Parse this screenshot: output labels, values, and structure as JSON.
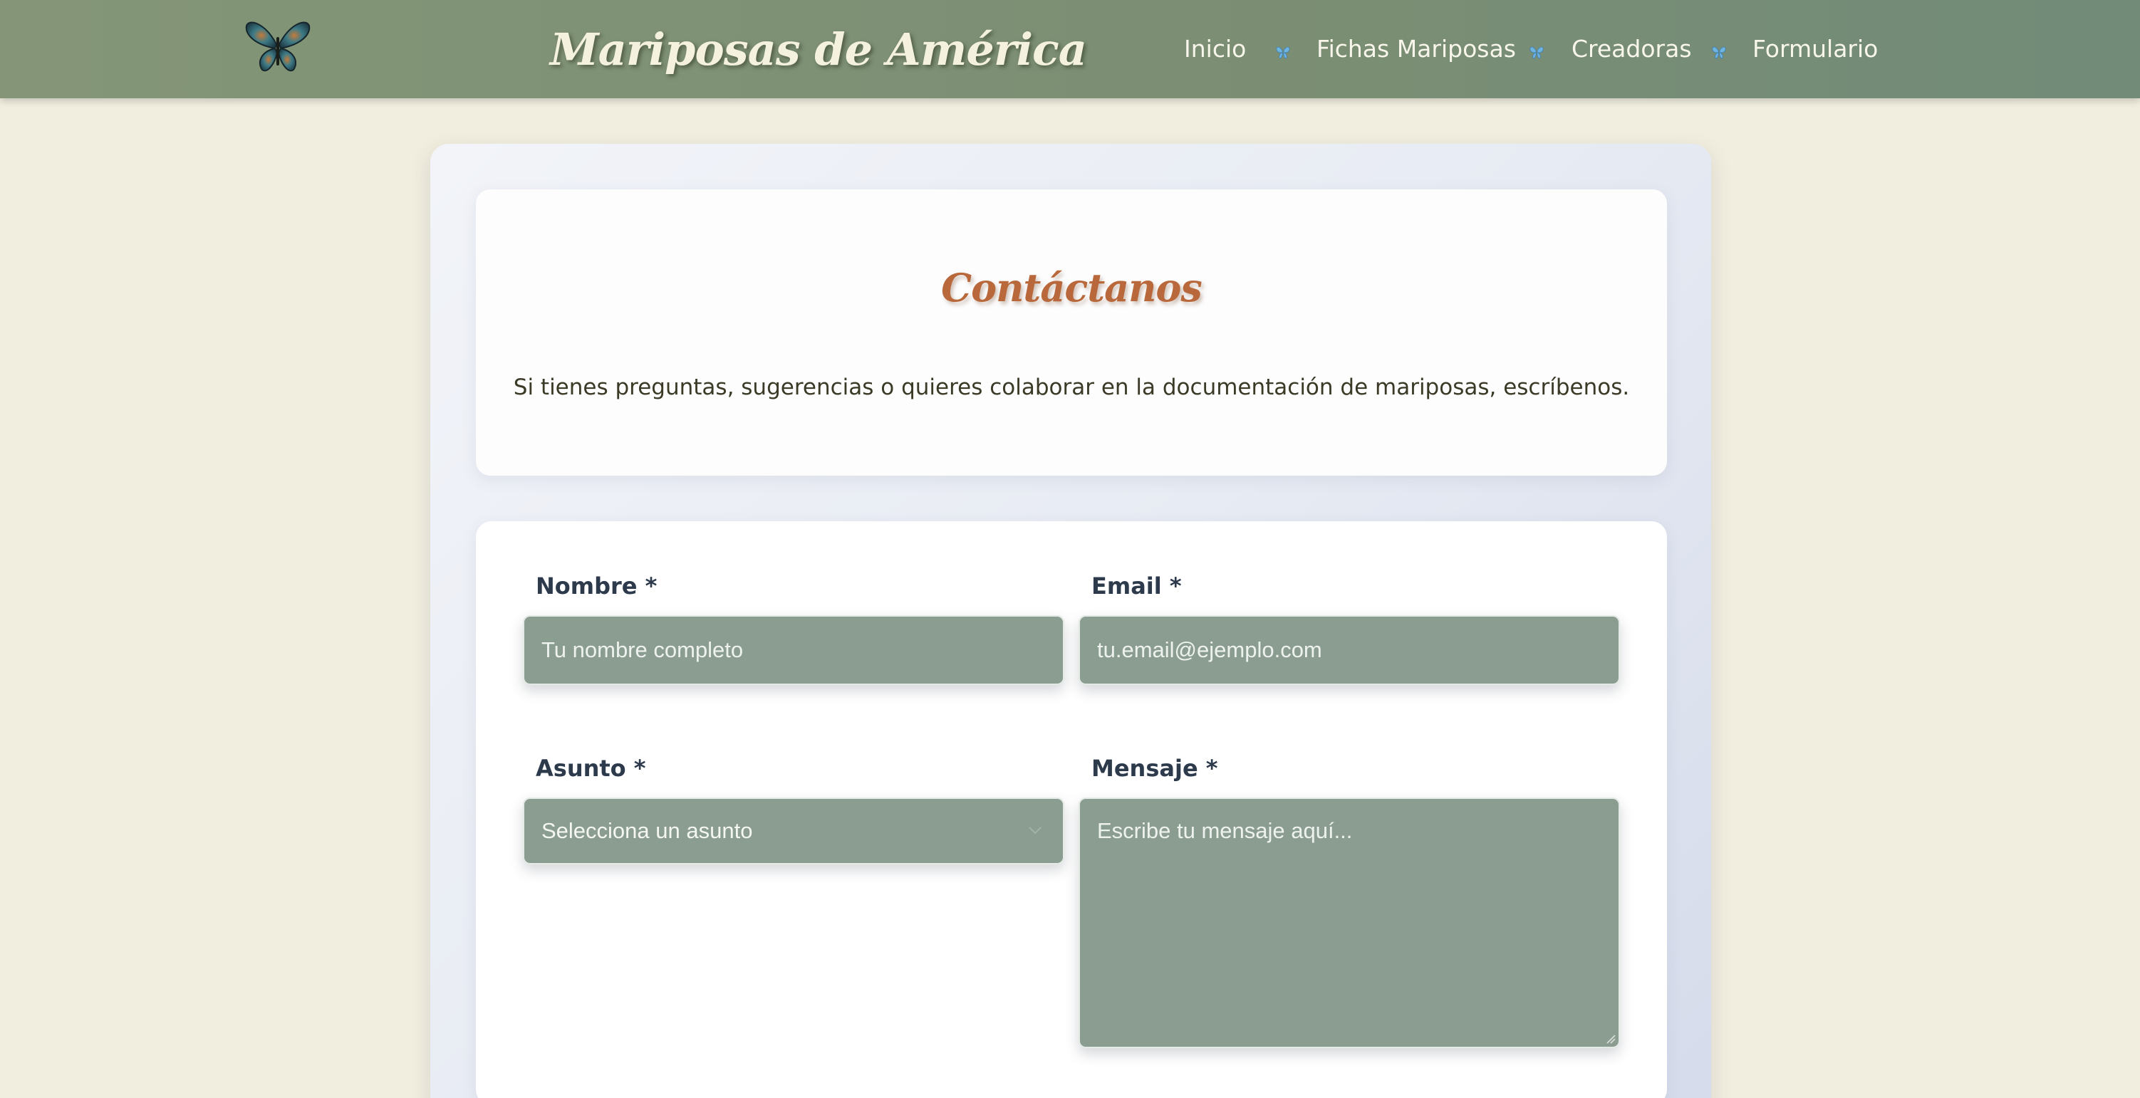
{
  "header": {
    "site_title": "Mariposas de América",
    "logo_icon": "butterfly-logo-icon",
    "nav": [
      {
        "label": "Inicio"
      },
      {
        "label": "Fichas Mariposas"
      },
      {
        "label": "Creadoras"
      },
      {
        "label": "Formulario"
      }
    ],
    "separator_icon": "butterfly-separator-icon"
  },
  "intro": {
    "title": "Contáctanos",
    "description": "Si tienes preguntas, sugerencias o quieres colaborar en la documentación de mariposas, escríbenos."
  },
  "form": {
    "name_label": "Nombre *",
    "name_placeholder": "Tu nombre completo",
    "email_label": "Email *",
    "email_placeholder": "tu.email@ejemplo.com",
    "subject_label": "Asunto *",
    "subject_selected": "Selecciona un asunto",
    "message_label": "Mensaje *",
    "message_placeholder": "Escribe tu mensaje aquí..."
  },
  "colors": {
    "header": "#7b8e74",
    "background": "#f1eedf",
    "accent_title": "#b8683b",
    "field": "#8b9d91"
  }
}
